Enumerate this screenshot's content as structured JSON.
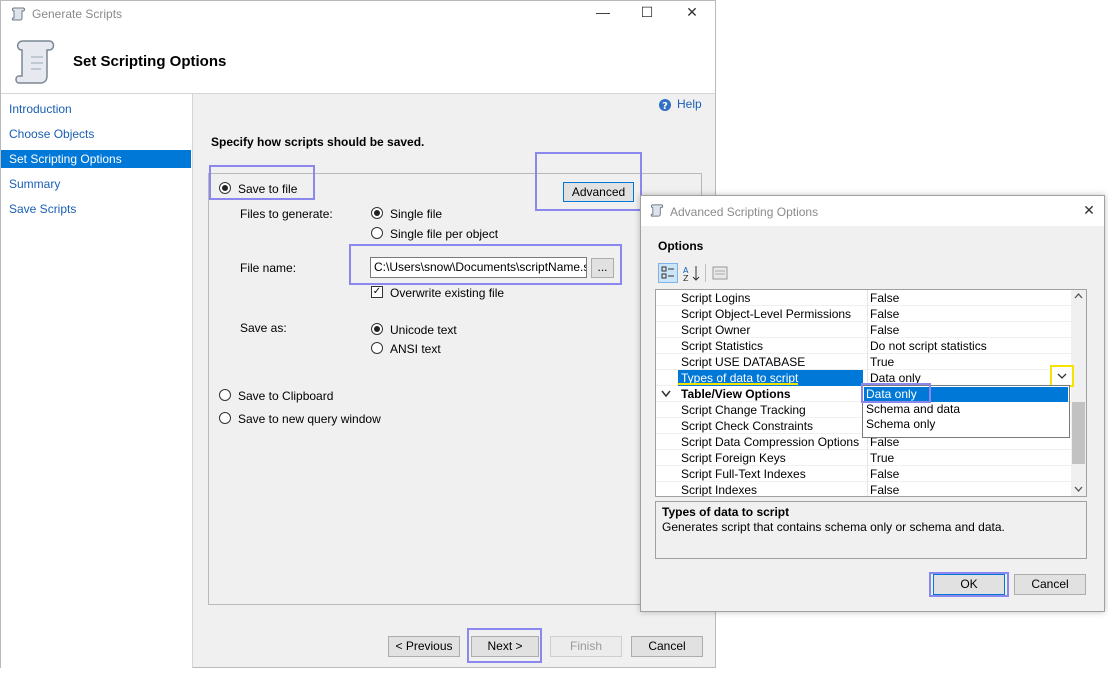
{
  "main_window": {
    "title": "Generate Scripts",
    "minimize": "—",
    "maximize": "☐",
    "close": "✕"
  },
  "header": {
    "title": "Set Scripting Options"
  },
  "nav": {
    "items": [
      "Introduction",
      "Choose Objects",
      "Set Scripting Options",
      "Summary",
      "Save Scripts"
    ],
    "selected_index": 2
  },
  "help": {
    "label": "Help"
  },
  "content": {
    "heading": "Specify how scripts should be saved.",
    "save_to_file": "Save to file",
    "advanced_button": "Advanced",
    "files_to_generate_label": "Files to generate:",
    "single_file": "Single file",
    "single_file_per_object": "Single file per object",
    "file_name_label": "File name:",
    "file_name_value": "C:\\Users\\snow\\Documents\\scriptName.sql",
    "browse_button": "...",
    "overwrite_label": "Overwrite existing file",
    "save_as_label": "Save as:",
    "unicode_text": "Unicode text",
    "ansi_text": "ANSI text",
    "save_to_clipboard": "Save to Clipboard",
    "save_to_new_query": "Save to new query window"
  },
  "footer": {
    "previous": "< Previous",
    "next": "Next >",
    "finish": "Finish",
    "cancel": "Cancel"
  },
  "dialog": {
    "title": "Advanced Scripting Options",
    "close": "✕",
    "options_label": "Options",
    "rows": [
      {
        "name": "Script Logins",
        "value": "False"
      },
      {
        "name": "Script Object-Level Permissions",
        "value": "False"
      },
      {
        "name": "Script Owner",
        "value": "False"
      },
      {
        "name": "Script Statistics",
        "value": "Do not script statistics"
      },
      {
        "name": "Script USE DATABASE",
        "value": "True"
      },
      {
        "name": "Types of data to script",
        "value": "Data only"
      },
      {
        "name": "Table/View Options",
        "value": ""
      },
      {
        "name": "Script Change Tracking",
        "value": ""
      },
      {
        "name": "Script Check Constraints",
        "value": ""
      },
      {
        "name": "Script Data Compression Options",
        "value": "False"
      },
      {
        "name": "Script Foreign Keys",
        "value": "True"
      },
      {
        "name": "Script Full-Text Indexes",
        "value": "False"
      },
      {
        "name": "Script Indexes",
        "value": "False"
      }
    ],
    "dropdown_options": [
      "Data only",
      "Schema and data",
      "Schema only"
    ],
    "description_title": "Types of data to script",
    "description_text": "Generates script that contains schema only or schema and data.",
    "ok": "OK",
    "cancel": "Cancel"
  },
  "colors": {
    "accent": "#0078d7",
    "highlight_box": "#8b87ec",
    "dropdown_highlight": "#f5e400",
    "nav_link": "#1a5fb4"
  }
}
